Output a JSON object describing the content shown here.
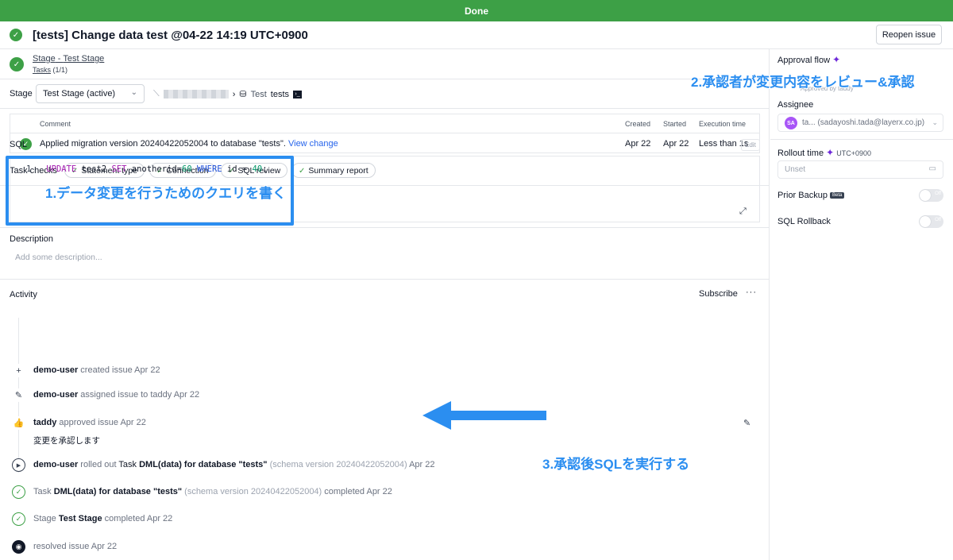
{
  "banner": "Done",
  "header": {
    "title": "[tests] Change data test @04-22 14:19 UTC+0900",
    "reopen_label": "Reopen issue"
  },
  "stage_bar": {
    "stage_prefix": "Stage",
    "separator": " - ",
    "stage_name": "Test Stage",
    "tasks_link": "Tasks",
    "tasks_count": " (1/1)"
  },
  "selector": {
    "label": "Stage",
    "value": "Test Stage (active)",
    "env_name": "Test",
    "database": "tests"
  },
  "task_table": {
    "headers": [
      "Comment",
      "Created",
      "Started",
      "Execution time"
    ],
    "row": {
      "comment": "Applied migration version 20240422052004 to database \"tests\".",
      "link": "View change",
      "created": "Apr 22",
      "started": "Apr 22",
      "execution_time": "Less than 1s"
    }
  },
  "task_checks": {
    "label": "Task checks",
    "items": [
      "Statement type",
      "Connection",
      "SQL review",
      "Summary report"
    ]
  },
  "sql": {
    "label": "SQL",
    "edit_label": "Edit",
    "line_number": "1",
    "tokens": {
      "k1": "UPDATE",
      "t1": " test2 ",
      "k2": "SET",
      "t2": " anotherid=",
      "n1": "60",
      "t3": " ",
      "k3": "WHERE",
      "t4": " id = ",
      "n2": "40",
      "t5": ";"
    }
  },
  "description": {
    "label": "Description",
    "placeholder": "Add some description..."
  },
  "activity": {
    "label": "Activity",
    "subscribe": "Subscribe",
    "more": "···",
    "items": [
      {
        "user": "demo-user",
        "text": " created issue Apr 22"
      },
      {
        "user": "demo-user",
        "text": " assigned issue to taddy Apr 22"
      },
      {
        "user": "taddy",
        "text": " approved issue Apr 22",
        "comment": "変更を承認します"
      },
      {
        "user": "demo-user",
        "t1": " rolled out ",
        "t2": "Task ",
        "task": "DML(data) for database \"tests\"",
        "schema": " (schema version 20240422052004) ",
        "date": "Apr 22"
      },
      {
        "t1": "Task ",
        "task": "DML(data) for database \"tests\"",
        "schema": " (schema version 20240422052004) ",
        "t2": "completed Apr 22"
      },
      {
        "t1": "Stage ",
        "stage": "Test Stage",
        "t2": " completed Apr 22"
      },
      {
        "text": "resolved issue Apr 22"
      }
    ]
  },
  "sidebar": {
    "approval_flow": "Approval flow",
    "approved_by": "Approved by taddy",
    "assignee_label": "Assignee",
    "assignee_initials": "SA",
    "assignee_value": "ta...   (sadayoshi.tada@layerx.co.jp)",
    "rollout_label": "Rollout time",
    "timezone": "UTC+0900",
    "rollout_placeholder": "Unset",
    "prior_backup": "Prior Backup",
    "beta": "Beta",
    "sql_rollback": "SQL Rollback",
    "toggle_off": "Off"
  },
  "annotations": {
    "step1": "1.データ変更を行うためのクエリを書く",
    "step2": "2.承認者が変更内容をレビュー&承認",
    "step3": "3.承認後SQLを実行する"
  },
  "colors": {
    "success": "#3da046",
    "annotation": "#2b8ef0",
    "link": "#2563eb"
  }
}
